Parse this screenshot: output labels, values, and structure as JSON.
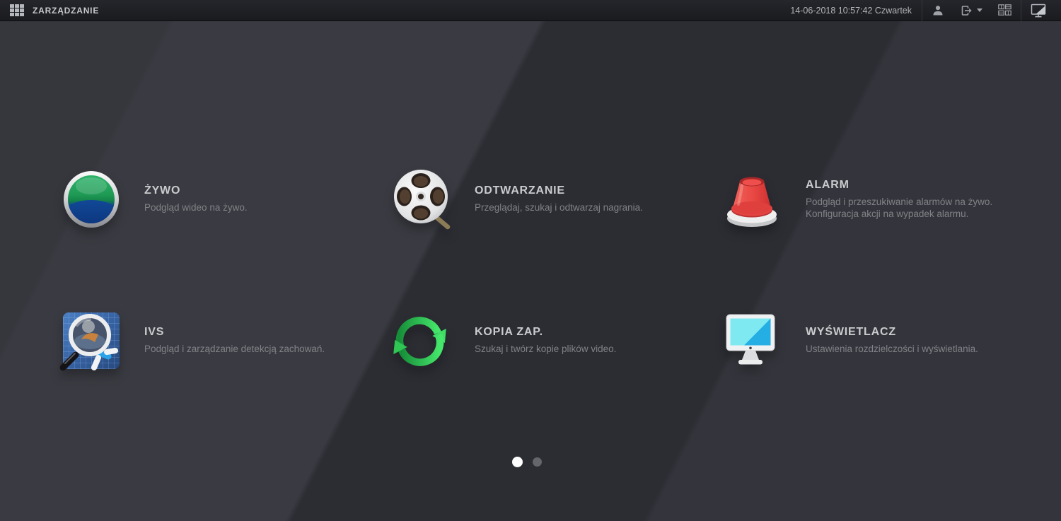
{
  "topbar": {
    "title": "ZARZĄDZANIE",
    "datetime": "14-06-2018 10:57:42 Czwartek",
    "toolbar_icons": [
      "apps-grid-icon",
      "user-icon",
      "logout-icon",
      "multi-screen-icon",
      "main-monitor-icon"
    ]
  },
  "menu": {
    "items": [
      {
        "id": "live",
        "title": "ŻYWO",
        "desc": "Podgląd wideo na żywo."
      },
      {
        "id": "playback",
        "title": "ODTWARZANIE",
        "desc": "Przeglądaj, szukaj i odtwarzaj nagrania."
      },
      {
        "id": "alarm",
        "title": "ALARM",
        "desc": "Podgląd i przeszukiwanie alarmów na żywo.\nKonfiguracja akcji na wypadek alarmu."
      },
      {
        "id": "ivs",
        "title": "IVS",
        "desc": "Podgląd i zarządzanie detekcją zachowań."
      },
      {
        "id": "backup",
        "title": "KOPIA ZAP.",
        "desc": "Szukaj i twórz kopie plików video."
      },
      {
        "id": "display",
        "title": "WYŚWIETLACZ",
        "desc": "Ustawienia rozdzielczości i wyświetlania."
      }
    ]
  },
  "pagination": {
    "count": 2,
    "active_index": 0
  },
  "colors": {
    "bg_base": "#2c2d33",
    "bg_band_left": "#3a3b42",
    "bg_band_right": "#34353c",
    "topbar_bg": "#1d1e23",
    "title_text": "#c9cbce",
    "desc_text": "#7f8287",
    "live_green": "#1f9a55",
    "live_blue": "#0c3584",
    "alarm_red": "#d83a3a",
    "backup_green": "#2fbf55",
    "display_cyan": "#2fb9e6",
    "ivs_blue": "#3668a8"
  }
}
